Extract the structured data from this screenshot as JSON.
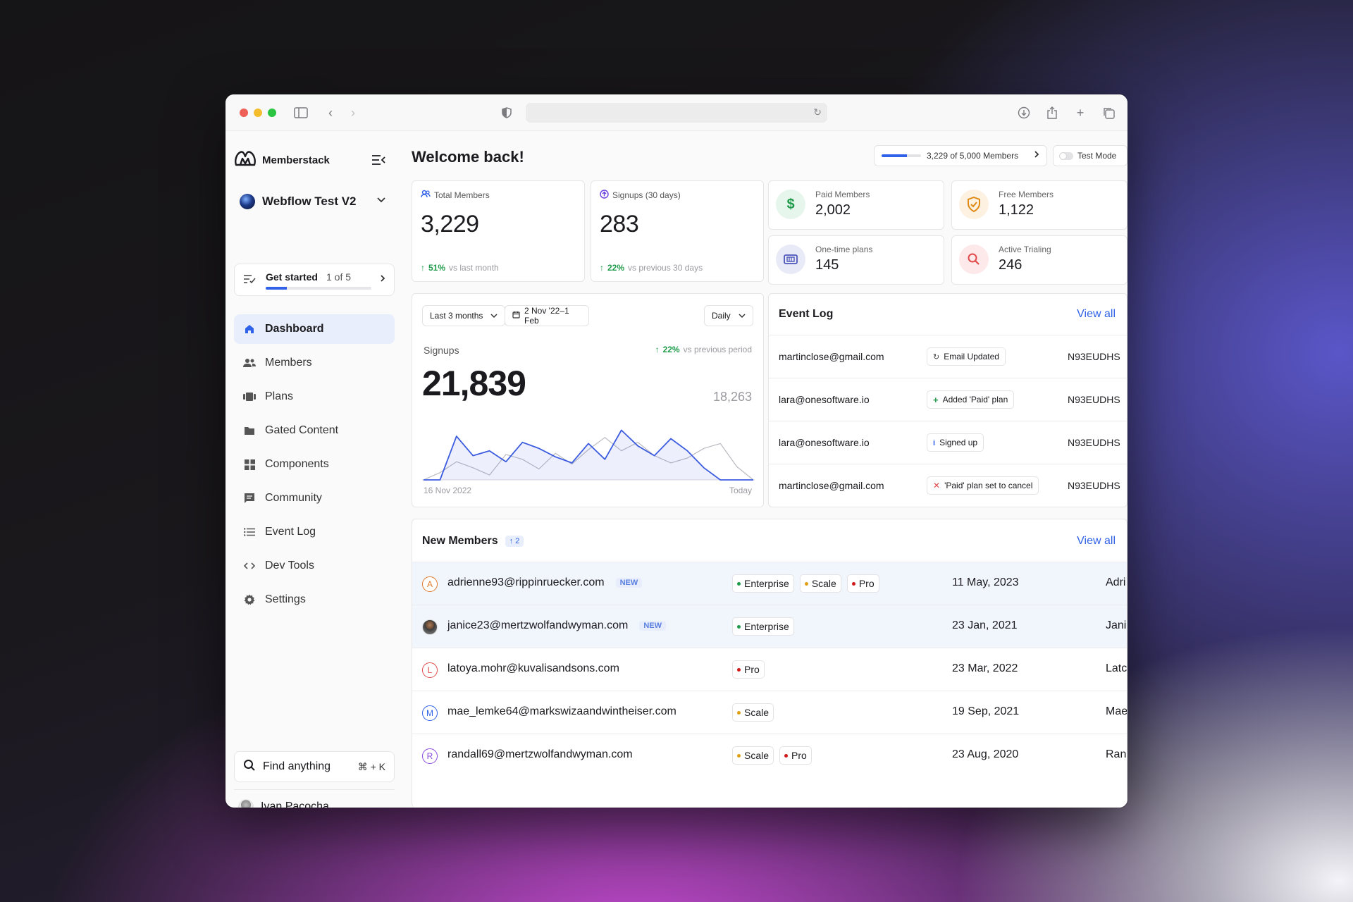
{
  "browser": {
    "url": ""
  },
  "sidebar": {
    "brand": "Memberstack",
    "workspace": "Webflow Test V2",
    "get_started": {
      "title": "Get started",
      "count": "1 of 5",
      "progress": 0.2
    },
    "items": [
      {
        "label": "Dashboard",
        "icon": "home-icon",
        "active": true
      },
      {
        "label": "Members",
        "icon": "users-icon"
      },
      {
        "label": "Plans",
        "icon": "plans-icon"
      },
      {
        "label": "Gated Content",
        "icon": "folder-icon"
      },
      {
        "label": "Components",
        "icon": "grid-icon"
      },
      {
        "label": "Community",
        "icon": "chat-icon"
      },
      {
        "label": "Event Log",
        "icon": "list-icon"
      },
      {
        "label": "Dev Tools",
        "icon": "code-icon"
      },
      {
        "label": "Settings",
        "icon": "gear-icon"
      }
    ],
    "find": {
      "label": "Find anything",
      "shortcut": "⌘ + K"
    },
    "user": {
      "name": "Ivan Pacocha"
    }
  },
  "header": {
    "title": "Welcome back!",
    "members_usage": {
      "text": "3,229 of 5,000 Members",
      "fraction": 0.6458
    },
    "test_mode": "Test Mode"
  },
  "stats": {
    "total_members": {
      "title": "Total Members",
      "value": "3,229",
      "change": "51%",
      "compare": "vs last month"
    },
    "signups": {
      "title": "Signups (30 days)",
      "value": "283",
      "change": "22%",
      "compare": "vs previous 30 days"
    }
  },
  "mini_stats": [
    {
      "title": "Paid Members",
      "value": "2,002",
      "icon": "dollar-icon",
      "color": "#1e9b4a",
      "bg": "#e7f6ec"
    },
    {
      "title": "Free Members",
      "value": "1,122",
      "icon": "shield-icon",
      "color": "#e08a12",
      "bg": "#fdf1e2"
    },
    {
      "title": "One-time plans",
      "value": "145",
      "icon": "ticket-icon",
      "color": "#4a56b8",
      "bg": "#e8eaf7"
    },
    {
      "title": "Active Trialing",
      "value": "246",
      "icon": "search-icon",
      "color": "#e04a4a",
      "bg": "#fde9e9"
    }
  ],
  "signups_chart": {
    "range_label": "Last 3 months",
    "date_label": "2 Nov '22–1 Feb",
    "interval_label": "Daily",
    "label": "Signups",
    "value": "21,839",
    "change": "22%",
    "compare": "vs previous period",
    "previous_value": "18,263",
    "x_start": "16 Nov 2022",
    "x_end": "Today"
  },
  "chart_data": {
    "type": "area",
    "title": "Signups",
    "xlabel": "",
    "ylabel": "",
    "x": [
      0,
      1,
      2,
      3,
      4,
      5,
      6,
      7,
      8,
      9,
      10,
      11,
      12,
      13,
      14,
      15,
      16,
      17,
      18,
      19,
      20
    ],
    "series": [
      {
        "values": [
          0,
          0,
          72,
          40,
          48,
          30,
          62,
          52,
          38,
          28,
          60,
          34,
          82,
          56,
          40,
          68,
          48,
          20,
          0,
          0,
          0
        ]
      },
      {
        "values": [
          0,
          12,
          30,
          20,
          8,
          42,
          34,
          18,
          44,
          26,
          50,
          70,
          48,
          62,
          40,
          28,
          36,
          52,
          60,
          22,
          0
        ]
      }
    ],
    "ylim": [
      0,
      100
    ],
    "grid": false,
    "legend": "none"
  },
  "event_log": {
    "title": "Event Log",
    "view_all": "View all",
    "rows": [
      {
        "email": "martinclose@gmail.com",
        "event": "Email Updated",
        "icon": "refresh-icon",
        "icon_color": "#444",
        "id": "N93EUDHS"
      },
      {
        "email": "lara@onesoftware.io",
        "event": "Added 'Paid' plan",
        "icon": "plus-icon",
        "icon_color": "#1e9b4a",
        "id": "N93EUDHS"
      },
      {
        "email": "lara@onesoftware.io",
        "event": "Signed up",
        "icon": "info-icon",
        "icon_color": "#2f62e8",
        "id": "N93EUDHS"
      },
      {
        "email": "martinclose@gmail.com",
        "event": "'Paid' plan set to cancel",
        "icon": "x-icon",
        "icon_color": "#e04a4a",
        "id": "N93EUDHS"
      }
    ]
  },
  "new_members": {
    "title": "New Members",
    "count_badge": "↑ 2",
    "view_all": "View all",
    "rows": [
      {
        "initial": "A",
        "color": "#e07a2a",
        "email": "adrienne93@rippinruecker.com",
        "new": "NEW",
        "plans": [
          {
            "name": "Enterprise",
            "color": "#1e9b4a"
          },
          {
            "name": "Scale",
            "color": "#e0a012"
          },
          {
            "name": "Pro",
            "color": "#d01a1a"
          }
        ],
        "date": "11 May, 2023",
        "name": "Adri",
        "highlight": true
      },
      {
        "initial": "",
        "photo": true,
        "color": "#555",
        "email": "janice23@mertzwolfandwyman.com",
        "new": "NEW",
        "plans": [
          {
            "name": "Enterprise",
            "color": "#1e9b4a"
          }
        ],
        "date": "23 Jan, 2021",
        "name": "Jani",
        "highlight": true
      },
      {
        "initial": "L",
        "color": "#e04a4a",
        "email": "latoya.mohr@kuvalisandsons.com",
        "new": "",
        "plans": [
          {
            "name": "Pro",
            "color": "#d01a1a"
          }
        ],
        "date": "23 Mar, 2022",
        "name": "Latc"
      },
      {
        "initial": "M",
        "color": "#2f62e8",
        "email": "mae_lemke64@markswizaandwintheiser.com",
        "new": "",
        "plans": [
          {
            "name": "Scale",
            "color": "#e0a012"
          }
        ],
        "date": "19 Sep, 2021",
        "name": "Mae"
      },
      {
        "initial": "R",
        "color": "#8a4ae0",
        "email": "randall69@mertzwolfandwyman.com",
        "new": "",
        "plans": [
          {
            "name": "Scale",
            "color": "#e0a012"
          },
          {
            "name": "Pro",
            "color": "#d01a1a"
          }
        ],
        "date": "23 Aug, 2020",
        "name": "Ran"
      }
    ]
  }
}
